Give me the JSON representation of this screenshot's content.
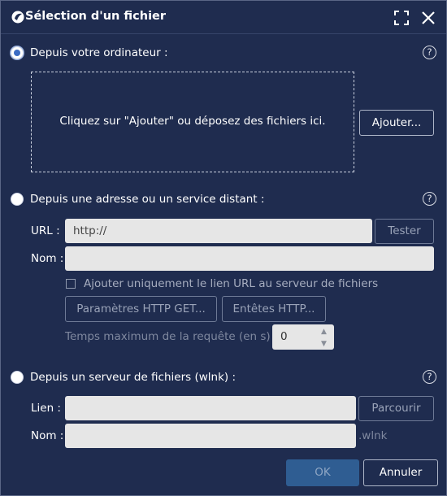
{
  "dialog": {
    "title": "Sélection d'un fichier"
  },
  "local": {
    "label": "Depuis votre ordinateur :",
    "dropzone_text": "Cliquez sur \"Ajouter\" ou déposez des fichiers ici.",
    "add_button": "Ajouter...",
    "selected": true
  },
  "remote": {
    "label": "Depuis une adresse ou un service distant :",
    "url_label": "URL :",
    "url_value": "http://",
    "test_button": "Tester",
    "name_label": "Nom :",
    "name_value": "",
    "checkbox_label": "Ajouter uniquement le lien URL au serveur de fichiers",
    "http_get_button": "Paramètres HTTP GET...",
    "headers_button": "Entêtes HTTP...",
    "timeout_label": "Temps maximum de la requête (en s) :",
    "timeout_value": "0",
    "selected": false
  },
  "server": {
    "label": "Depuis un serveur de fichiers (wlnk) :",
    "link_label": "Lien :",
    "link_value": "",
    "browse_button": "Parcourir",
    "name_label": "Nom :",
    "name_value": "",
    "suffix": ".wlnk",
    "selected": false
  },
  "footer": {
    "ok_button": "OK",
    "cancel_button": "Annuler"
  },
  "help_glyph": "?",
  "colors": {
    "background": "#1f2c4f",
    "ok_button": "#2f5d92",
    "input": "#e6e6e6"
  }
}
